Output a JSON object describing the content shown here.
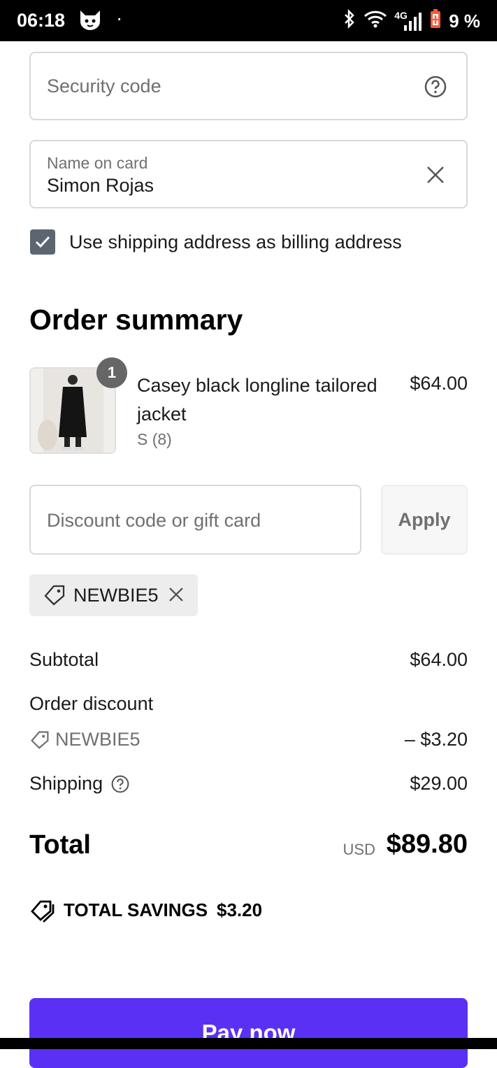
{
  "status_bar": {
    "time": "06:18",
    "dot": "·",
    "network": "4G",
    "battery": "9 %"
  },
  "payment": {
    "security_placeholder": "Security code",
    "name_label": "Name on card",
    "name_value": "Simon Rojas",
    "billing_checkbox_label": "Use shipping address as billing address",
    "billing_checked": true
  },
  "order": {
    "title": "Order summary",
    "item": {
      "name": "Casey black longline tailored jacket",
      "variant": "S (8)",
      "price": "$64.00",
      "quantity": "1"
    }
  },
  "discount": {
    "placeholder": "Discount code or gift card",
    "apply_label": "Apply",
    "applied_code": "NEWBIE5"
  },
  "totals": {
    "subtotal_label": "Subtotal",
    "subtotal_value": "$64.00",
    "order_discount_label": "Order discount",
    "discount_code": "NEWBIE5",
    "discount_value": "– $3.20",
    "shipping_label": "Shipping",
    "shipping_value": "$29.00",
    "total_label": "Total",
    "currency": "USD",
    "total_value": "$89.80",
    "savings_label": "TOTAL SAVINGS",
    "savings_value": "$3.20"
  },
  "pay_button_label": "Pay now",
  "colors": {
    "accent": "#5a31f4",
    "checkbox": "#5b6670",
    "muted_text": "#707070"
  }
}
